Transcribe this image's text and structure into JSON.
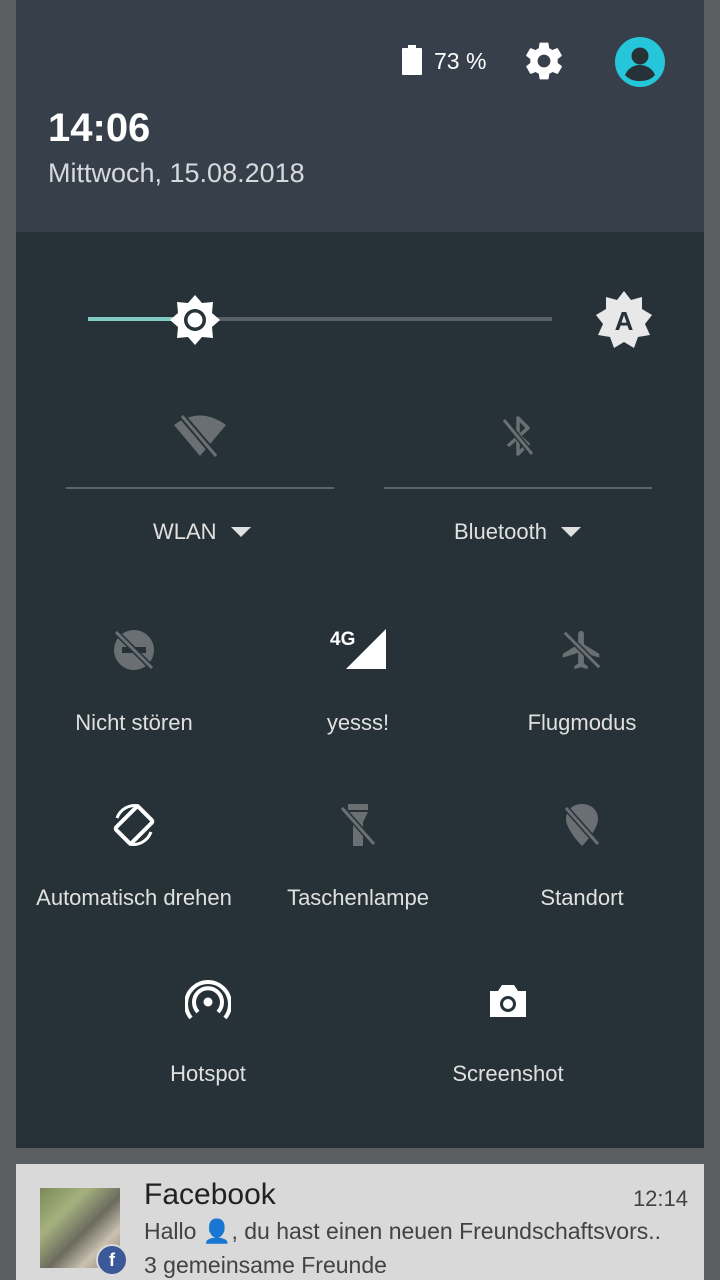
{
  "status": {
    "battery_percent": "73 %",
    "time": "14:06",
    "date": "Mittwoch, 15.08.2018"
  },
  "brightness": {
    "level": 0.23,
    "auto_icon": "brightness-auto-icon"
  },
  "toggles_big": [
    {
      "label": "WLAN",
      "icon": "wifi-off-icon"
    },
    {
      "label": "Bluetooth",
      "icon": "bluetooth-off-icon"
    }
  ],
  "tiles": [
    {
      "label": "Nicht stören",
      "icon": "do-not-disturb-off-icon"
    },
    {
      "label": "yesss!",
      "icon": "signal-4g-icon",
      "network_type": "4G"
    },
    {
      "label": "Flugmodus",
      "icon": "airplane-off-icon"
    },
    {
      "label": "Automatisch drehen",
      "icon": "auto-rotate-icon"
    },
    {
      "label": "Taschenlampe",
      "icon": "flashlight-off-icon"
    },
    {
      "label": "Standort",
      "icon": "location-off-icon"
    },
    {
      "label": "Hotspot",
      "icon": "hotspot-icon"
    },
    {
      "label": "Screenshot",
      "icon": "camera-icon"
    }
  ],
  "notification": {
    "app": "Facebook",
    "time": "12:14",
    "text": "Hallo 👤, du hast einen neuen Freundschaftsvors..",
    "subtext": "3 gemeinsame Freunde",
    "badge": "f"
  },
  "colors": {
    "accent": "#80cbc4",
    "avatar": "#26c6da",
    "panel": "#263238",
    "header": "#37404a"
  }
}
